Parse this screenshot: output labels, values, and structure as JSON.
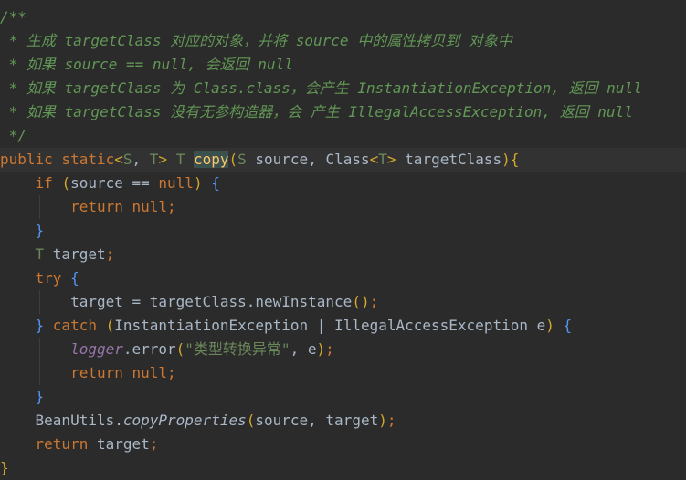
{
  "editor": {
    "lines": [
      [
        {
          "t": "/**",
          "c": "cmt"
        }
      ],
      [
        {
          "t": " * 生成 targetClass 对应的对象，并将 source 中的属性拷贝到 对象中",
          "c": "cmt"
        }
      ],
      [
        {
          "t": " * 如果 source == null, 会返回 null",
          "c": "cmt"
        }
      ],
      [
        {
          "t": " * 如果 targetClass 为 Class.class，会产生 InstantiationException, 返回 null",
          "c": "cmt"
        }
      ],
      [
        {
          "t": " * 如果 targetClass 没有无参构造器，会 产生 IllegalAccessException, 返回 null",
          "c": "cmt"
        }
      ],
      [
        {
          "t": " */",
          "c": "cmt"
        }
      ],
      [
        {
          "t": "public ",
          "c": "kw"
        },
        {
          "t": "static",
          "c": "kw"
        },
        {
          "t": "<",
          "c": "br"
        },
        {
          "t": "S",
          "c": "tp"
        },
        {
          "t": ", ",
          "c": "pl"
        },
        {
          "t": "T",
          "c": "tp"
        },
        {
          "t": "> ",
          "c": "br"
        },
        {
          "t": "T ",
          "c": "tp"
        },
        {
          "t": "copy",
          "c": "hl"
        },
        {
          "t": "(",
          "c": "br"
        },
        {
          "t": "S ",
          "c": "tp"
        },
        {
          "t": "source, Class",
          "c": "pl"
        },
        {
          "t": "<",
          "c": "br"
        },
        {
          "t": "T",
          "c": "tp"
        },
        {
          "t": "> ",
          "c": "br"
        },
        {
          "t": "targetClass",
          "c": "pl"
        },
        {
          "t": ")",
          "c": "br"
        },
        {
          "t": "{",
          "c": "br"
        }
      ],
      [
        {
          "t": "    if ",
          "c": "kw"
        },
        {
          "t": "(",
          "c": "br"
        },
        {
          "t": "source == ",
          "c": "pl"
        },
        {
          "t": "null",
          "c": "kw"
        },
        {
          "t": ") ",
          "c": "br"
        },
        {
          "t": "{",
          "c": "br2"
        }
      ],
      [
        {
          "t": "        return ",
          "c": "kw"
        },
        {
          "t": "null",
          "c": "kw"
        },
        {
          "t": ";",
          "c": "kw"
        }
      ],
      [
        {
          "t": "    }",
          "c": "br2"
        }
      ],
      [
        {
          "t": "    T ",
          "c": "tp"
        },
        {
          "t": "target",
          "c": "pl"
        },
        {
          "t": ";",
          "c": "kw"
        }
      ],
      [
        {
          "t": "    try ",
          "c": "kw"
        },
        {
          "t": "{",
          "c": "br2"
        }
      ],
      [
        {
          "t": "        target = targetClass.newInstance",
          "c": "pl"
        },
        {
          "t": "()",
          "c": "br"
        },
        {
          "t": ";",
          "c": "kw"
        }
      ],
      [
        {
          "t": "    } ",
          "c": "br2"
        },
        {
          "t": "catch ",
          "c": "kw"
        },
        {
          "t": "(",
          "c": "br"
        },
        {
          "t": "InstantiationException | IllegalAccessException e",
          "c": "pl"
        },
        {
          "t": ") ",
          "c": "br"
        },
        {
          "t": "{",
          "c": "br2"
        }
      ],
      [
        {
          "t": "        ",
          "c": "pl"
        },
        {
          "t": "logger",
          "c": "fld"
        },
        {
          "t": ".error",
          "c": "pl"
        },
        {
          "t": "(",
          "c": "br"
        },
        {
          "t": "\"类型转换异常\"",
          "c": "str"
        },
        {
          "t": ", e",
          "c": "pl"
        },
        {
          "t": ")",
          "c": "br"
        },
        {
          "t": ";",
          "c": "kw"
        }
      ],
      [
        {
          "t": "        return ",
          "c": "kw"
        },
        {
          "t": "null",
          "c": "kw"
        },
        {
          "t": ";",
          "c": "kw"
        }
      ],
      [
        {
          "t": "    }",
          "c": "br2"
        }
      ],
      [
        {
          "t": "    BeanUtils.",
          "c": "pl"
        },
        {
          "t": "copyProperties",
          "c": "sm"
        },
        {
          "t": "(",
          "c": "br"
        },
        {
          "t": "source, target",
          "c": "pl"
        },
        {
          "t": ")",
          "c": "br"
        },
        {
          "t": ";",
          "c": "kw"
        }
      ],
      [
        {
          "t": "    return ",
          "c": "kw"
        },
        {
          "t": "target",
          "c": "pl"
        },
        {
          "t": ";",
          "c": "kw"
        }
      ],
      [
        {
          "t": "}",
          "c": "br"
        }
      ]
    ]
  }
}
